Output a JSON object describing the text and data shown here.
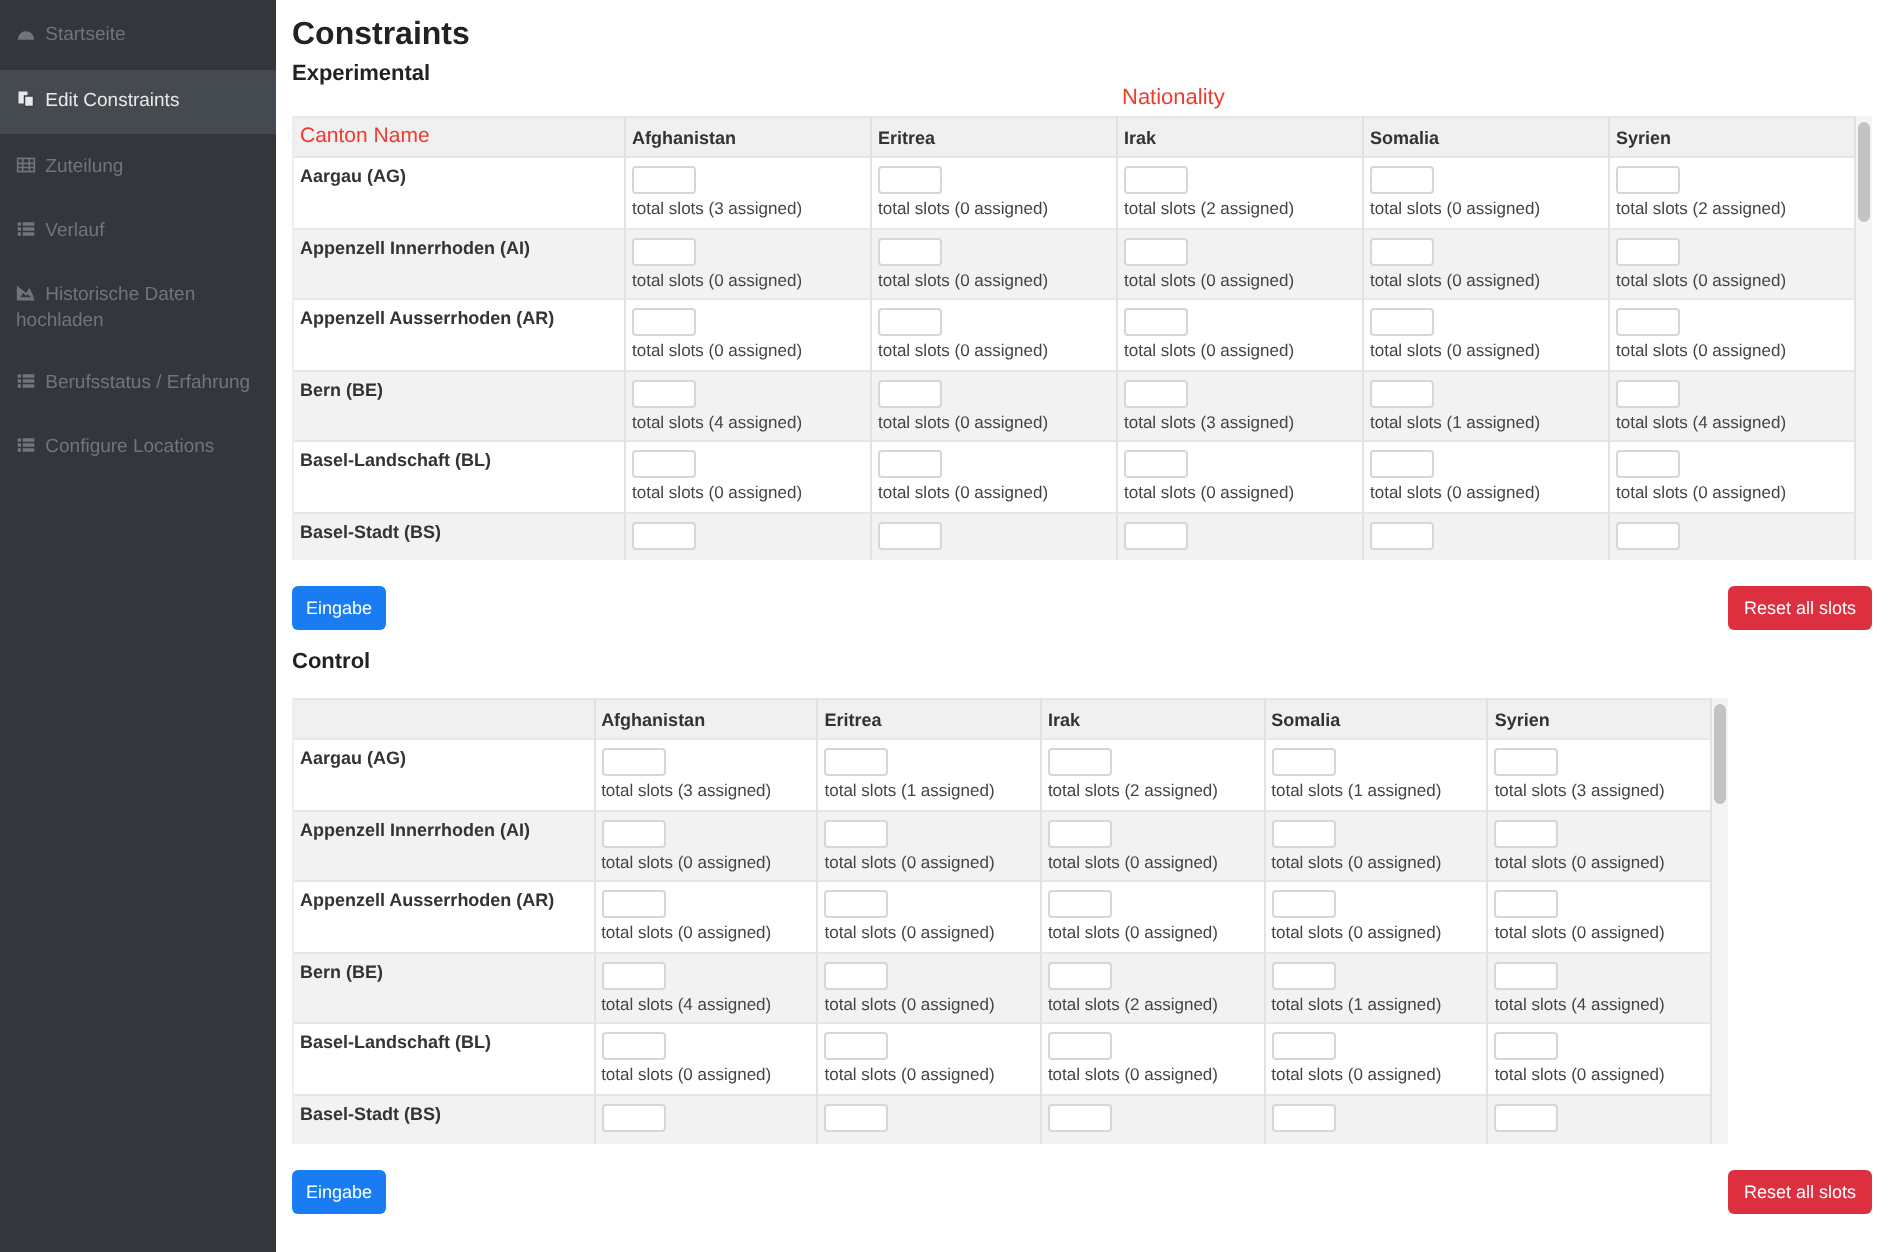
{
  "sidebar": {
    "items": [
      {
        "label": "Startseite",
        "kind": "dashboard",
        "selected": false
      },
      {
        "label": "Edit Constraints",
        "kind": "copy",
        "selected": true
      },
      {
        "label": "Zuteilung",
        "kind": "table",
        "selected": false
      },
      {
        "label": "Verlauf",
        "kind": "list",
        "selected": false
      },
      {
        "label": "Historische Daten hochladen",
        "kind": "chart",
        "selected": false
      },
      {
        "label": "Berufsstatus / Erfahrung",
        "kind": "list",
        "selected": false
      },
      {
        "label": "Configure Locations",
        "kind": "list",
        "selected": false
      }
    ]
  },
  "title": "Constraints",
  "sections": [
    {
      "heading": "Experimental",
      "annotation": "Nationality",
      "corner_label": "Canton Name",
      "columns": [
        "Afghanistan",
        "Eritrea",
        "Irak",
        "Somalia",
        "Syrien"
      ],
      "rows": [
        {
          "name": "Aargau (AG)",
          "cells": [
            "total slots (3 assigned)",
            "total slots (0 assigned)",
            "total slots (2 assigned)",
            "total slots (0 assigned)",
            "total slots (2 assigned)"
          ]
        },
        {
          "name": "Appenzell Innerrhoden (AI)",
          "cells": [
            "total slots (0 assigned)",
            "total slots (0 assigned)",
            "total slots (0 assigned)",
            "total slots (0 assigned)",
            "total slots (0 assigned)"
          ]
        },
        {
          "name": "Appenzell Ausserrhoden (AR)",
          "cells": [
            "total slots (0 assigned)",
            "total slots (0 assigned)",
            "total slots (0 assigned)",
            "total slots (0 assigned)",
            "total slots (0 assigned)"
          ]
        },
        {
          "name": "Bern (BE)",
          "cells": [
            "total slots (4 assigned)",
            "total slots (0 assigned)",
            "total slots (3 assigned)",
            "total slots (1 assigned)",
            "total slots (4 assigned)"
          ]
        },
        {
          "name": "Basel-Landschaft (BL)",
          "cells": [
            "total slots (0 assigned)",
            "total slots (0 assigned)",
            "total slots (0 assigned)",
            "total slots (0 assigned)",
            "total slots (0 assigned)"
          ]
        },
        {
          "name": "Basel-Stadt (BS)",
          "cells": []
        }
      ],
      "submit": "Eingabe",
      "reset": "Reset all slots"
    },
    {
      "heading": "Control",
      "columns": [
        "Afghanistan",
        "Eritrea",
        "Irak",
        "Somalia",
        "Syrien"
      ],
      "rows": [
        {
          "name": "Aargau (AG)",
          "cells": [
            "total slots (3 assigned)",
            "total slots (1 assigned)",
            "total slots (2 assigned)",
            "total slots (1 assigned)",
            "total slots (3 assigned)"
          ]
        },
        {
          "name": "Appenzell Innerrhoden (AI)",
          "cells": [
            "total slots (0 assigned)",
            "total slots (0 assigned)",
            "total slots (0 assigned)",
            "total slots (0 assigned)",
            "total slots (0 assigned)"
          ]
        },
        {
          "name": "Appenzell Ausserrhoden (AR)",
          "cells": [
            "total slots (0 assigned)",
            "total slots (0 assigned)",
            "total slots (0 assigned)",
            "total slots (0 assigned)",
            "total slots (0 assigned)"
          ]
        },
        {
          "name": "Bern (BE)",
          "cells": [
            "total slots (4 assigned)",
            "total slots (0 assigned)",
            "total slots (2 assigned)",
            "total slots (1 assigned)",
            "total slots (4 assigned)"
          ]
        },
        {
          "name": "Basel-Landschaft (BL)",
          "cells": [
            "total slots (0 assigned)",
            "total slots (0 assigned)",
            "total slots (0 assigned)",
            "total slots (0 assigned)",
            "total slots (0 assigned)"
          ]
        },
        {
          "name": "Basel-Stadt (BS)",
          "cells": []
        }
      ],
      "submit": "Eingabe",
      "reset": "Reset all slots"
    }
  ]
}
